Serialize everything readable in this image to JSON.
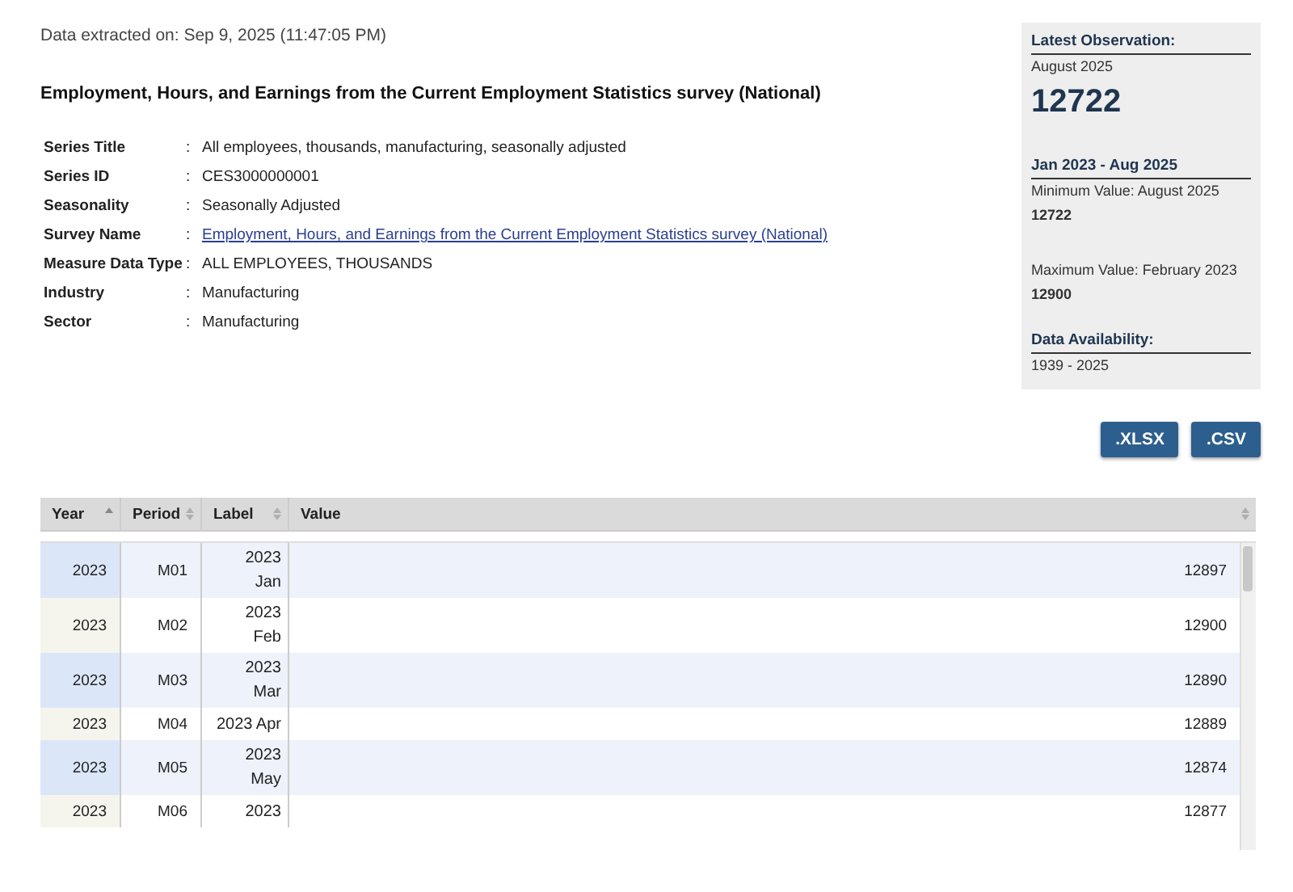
{
  "extracted": "Data extracted on: Sep 9, 2025 (11:47:05 PM)",
  "title": "Employment, Hours, and Earnings from the Current Employment Statistics survey (National)",
  "details": [
    {
      "label": "Series Title",
      "value": "All employees, thousands, manufacturing, seasonally adjusted",
      "kind": "text"
    },
    {
      "label": "Series ID",
      "value": "CES3000000001",
      "kind": "text"
    },
    {
      "label": "Seasonality",
      "value": "Seasonally Adjusted",
      "kind": "text"
    },
    {
      "label": "Survey Name",
      "value": "Employment, Hours, and Earnings from the Current Employment Statistics survey (National)",
      "kind": "link"
    },
    {
      "label": "Measure Data Type",
      "value": "ALL EMPLOYEES, THOUSANDS",
      "kind": "text"
    },
    {
      "label": "Industry",
      "value": "Manufacturing",
      "kind": "text"
    },
    {
      "label": "Sector",
      "value": "Manufacturing",
      "kind": "text"
    }
  ],
  "separator": ":",
  "summary": {
    "latest_heading": "Latest Observation:",
    "latest_period": "August 2025",
    "latest_value": "12722",
    "range_heading": "Jan 2023 - Aug 2025",
    "min_label": "Minimum Value: August 2025",
    "min_value": "12722",
    "max_label": "Maximum Value: February 2023",
    "max_value": "12900",
    "availability_heading": "Data Availability:",
    "availability": "1939 - 2025"
  },
  "downloads": [
    ".XLSX",
    ".CSV"
  ],
  "table": {
    "columns": [
      {
        "label": "Year",
        "sorted": true
      },
      {
        "label": "Period",
        "sorted": false
      },
      {
        "label": "Label",
        "sorted": false
      },
      {
        "label": "Value",
        "sorted": false
      }
    ],
    "rows": [
      [
        "2023",
        "M01",
        "2023 Jan",
        "12897"
      ],
      [
        "2023",
        "M02",
        "2023 Feb",
        "12900"
      ],
      [
        "2023",
        "M03",
        "2023 Mar",
        "12890"
      ],
      [
        "2023",
        "M04",
        "2023 Apr",
        "12889"
      ],
      [
        "2023",
        "M05",
        "2023 May",
        "12874"
      ],
      [
        "2023",
        "M06",
        "2023",
        "12877"
      ]
    ]
  }
}
